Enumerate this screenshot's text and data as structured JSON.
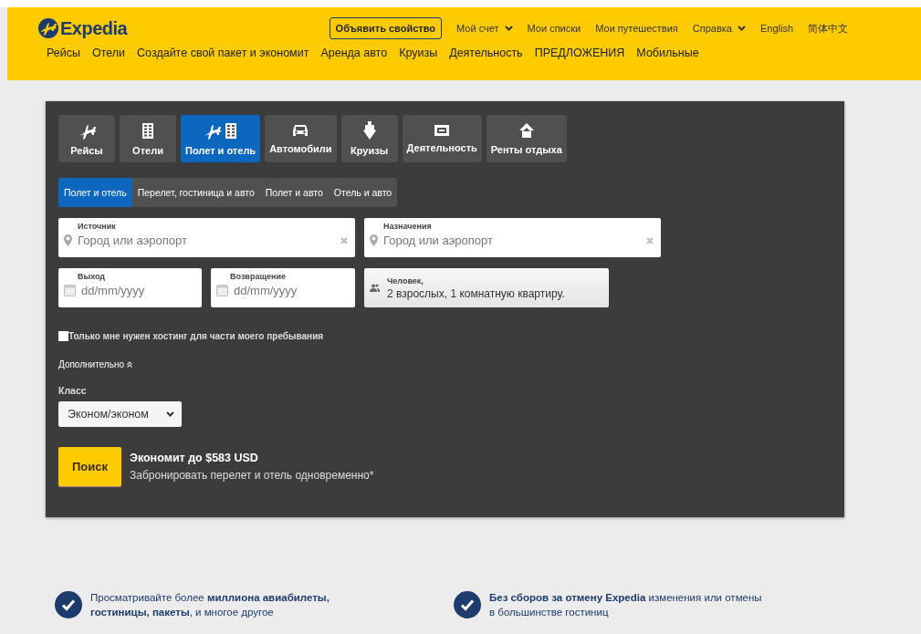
{
  "header": {
    "logo": "Expedia",
    "top_links": [
      {
        "label": "Объявить свойство",
        "kind": "button",
        "has_menu": false
      },
      {
        "label": "Мой счет",
        "kind": "link",
        "has_menu": true
      },
      {
        "label": "Мои списки",
        "kind": "link",
        "has_menu": false
      },
      {
        "label": "Мои путешествия",
        "kind": "link",
        "has_menu": false
      },
      {
        "label": "Справка",
        "kind": "link",
        "has_menu": true
      },
      {
        "label": "English",
        "kind": "link",
        "has_menu": false
      },
      {
        "label": "简体中文",
        "kind": "link",
        "has_menu": false
      }
    ],
    "nav": [
      "Рейсы",
      "Отели",
      "Создайте свой пакет и экономит",
      "Аренда авто",
      "Круизы",
      "Деятельность",
      "ПРЕДЛОЖЕНИЯ",
      "Мобильные"
    ]
  },
  "search_panel": {
    "tabs": [
      {
        "label": "Рейсы",
        "selected": false
      },
      {
        "label": "Отели",
        "selected": false
      },
      {
        "label": "Полет и отель",
        "selected": true
      },
      {
        "label": "Автомобили",
        "selected": false
      },
      {
        "label": "Круизы",
        "selected": false
      },
      {
        "label": "Деятельность",
        "selected": false
      },
      {
        "label": "Ренты отдыха",
        "selected": false
      }
    ],
    "subtabs": [
      {
        "label": "Полет и отель",
        "selected": true
      },
      {
        "label": "Перелет, гостиница и авто",
        "selected": false
      },
      {
        "label": "Полет и авто",
        "selected": false
      },
      {
        "label": "Отель и авто",
        "selected": false
      }
    ],
    "origin": {
      "label": "Источник",
      "placeholder": "Город или аэропорт"
    },
    "destination": {
      "label": "Назначения",
      "placeholder": "Город или аэропорт"
    },
    "departure": {
      "label": "Выход",
      "placeholder": "dd/mm/yyyy"
    },
    "return": {
      "label": "Возвращение",
      "placeholder": "dd/mm/yyyy"
    },
    "travelers": {
      "label": "Человек,",
      "value": "2 взрослых, 1 комнатную квартиру."
    },
    "partial_stay": {
      "label": "Только мне нужен хостинг для части моего пребывания",
      "checked": false
    },
    "advanced": {
      "label": "Дополнительно",
      "expanded": true
    },
    "class": {
      "label": "Класс",
      "value": "Эконом/эконом"
    },
    "search_button": "Поиск",
    "savings": {
      "title": "Экономит до $583 USD",
      "subtitle": "Забронировать перелет и отель одновременно*"
    }
  },
  "features": [
    "Просматривайте более **миллиона авиабилеты, гостиницы, пакеты**, и многое другое",
    "**Без сборов за отмену Expedia** изменения или отмены в большинстве гостиниц"
  ]
}
